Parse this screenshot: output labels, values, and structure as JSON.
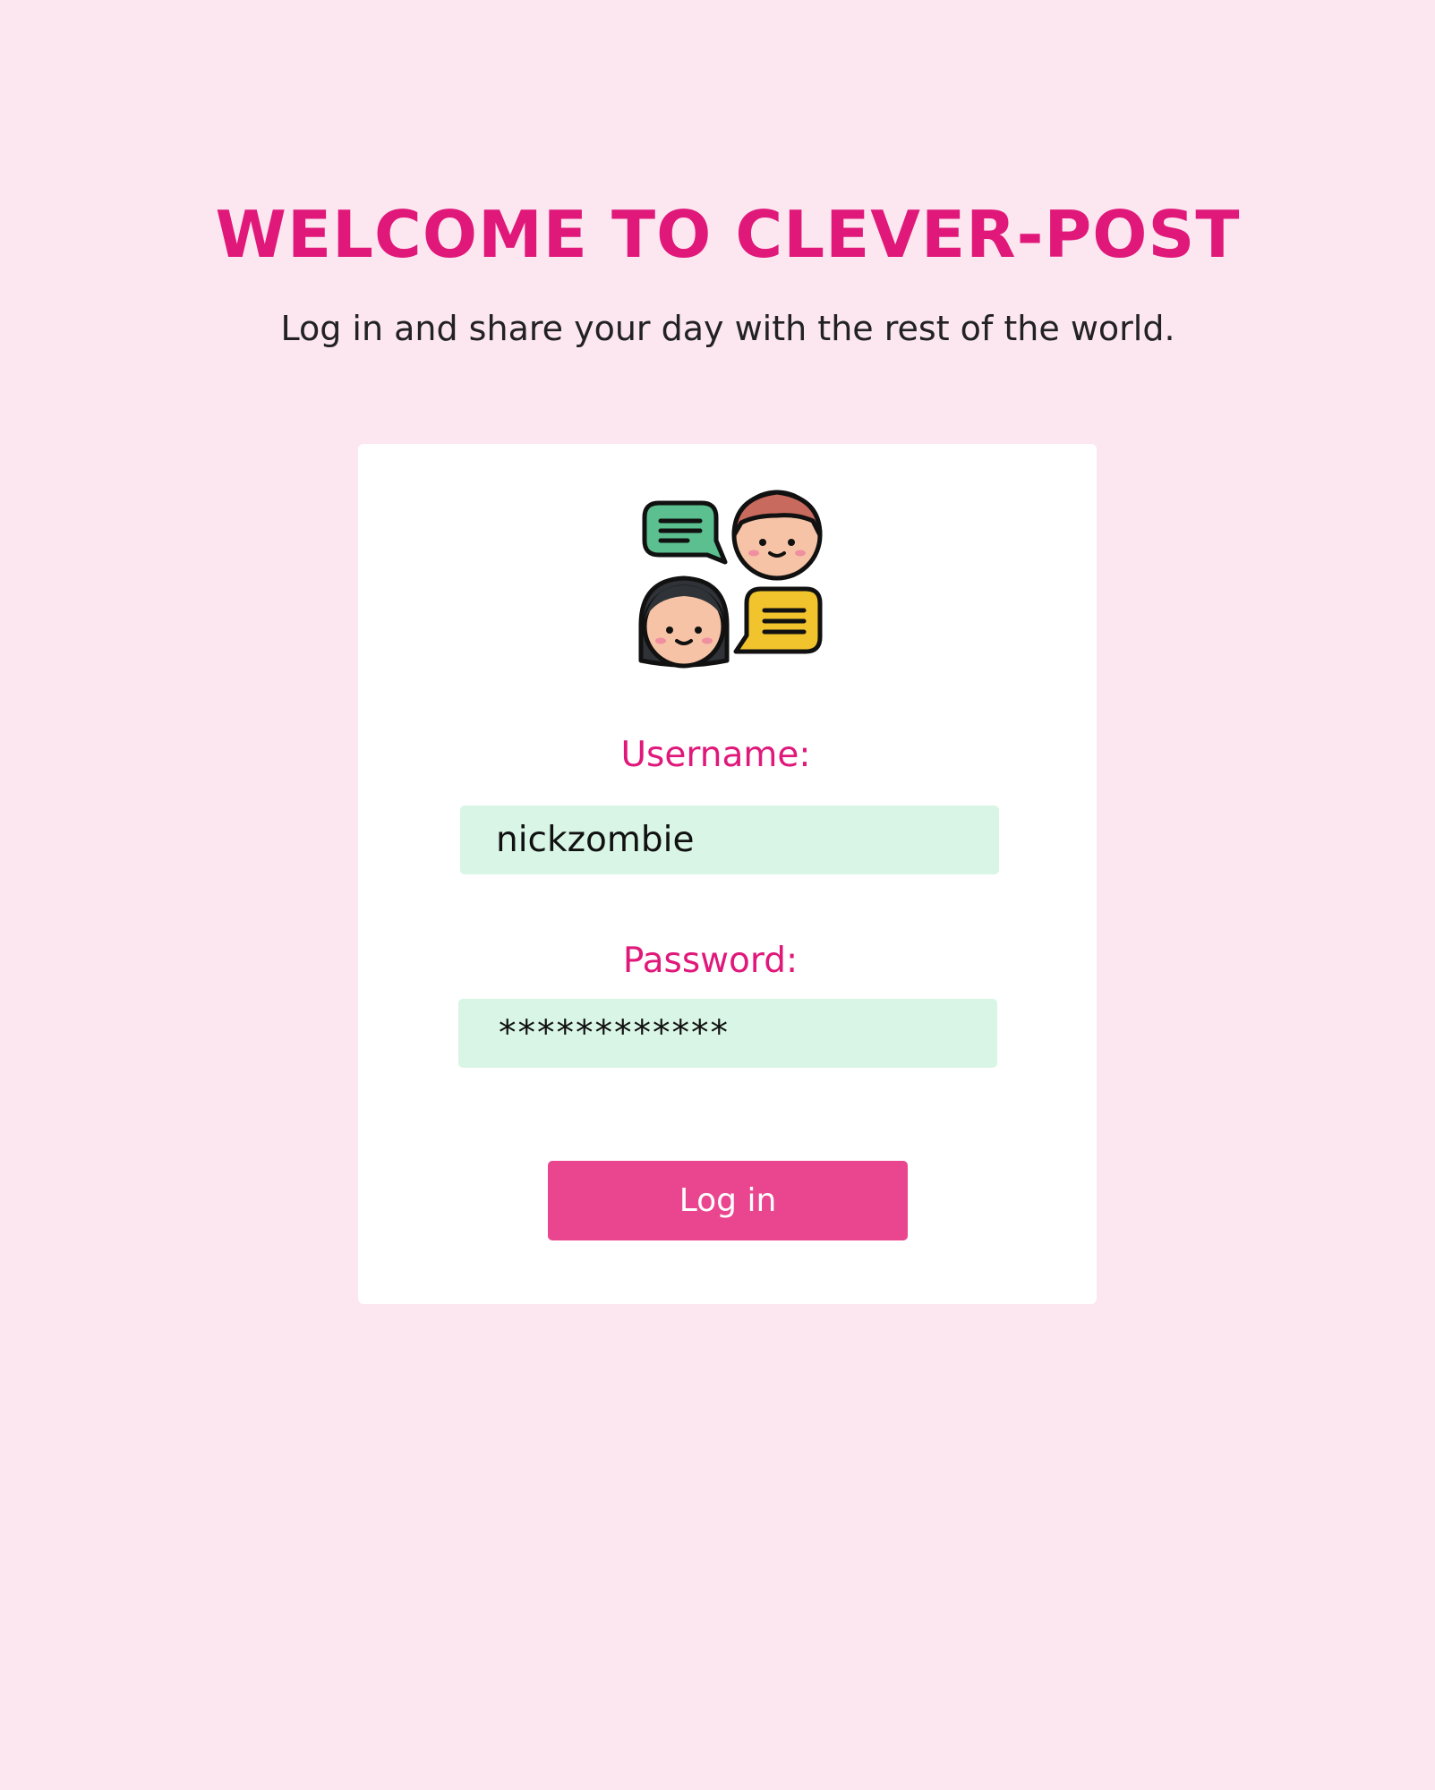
{
  "header": {
    "title": "WELCOME TO CLEVER-POST",
    "subtitle": "Log in and share your day with the rest of the world."
  },
  "login_form": {
    "logo_icon": "chatting-people-icon",
    "username_label": "Username:",
    "username_value": "nickzombie",
    "password_label": "Password:",
    "password_value": "************",
    "submit_label": "Log in"
  },
  "colors": {
    "page_background": "#fce6f0",
    "accent": "#e0187a",
    "button": "#ea4690",
    "input_background": "#d8f5e6",
    "card_background": "#ffffff"
  }
}
